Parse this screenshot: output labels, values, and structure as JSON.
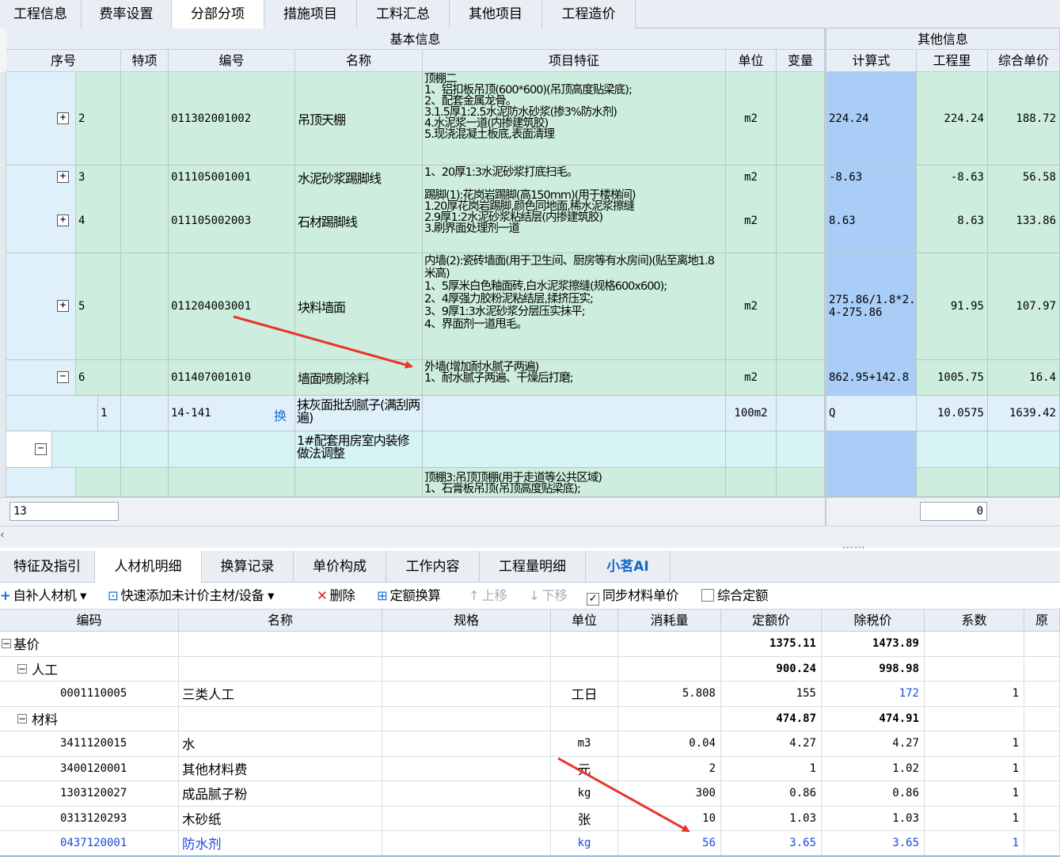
{
  "top_tabs": [
    "工程信息",
    "费率设置",
    "分部分项",
    "措施项目",
    "工料汇总",
    "其他项目",
    "工程造价"
  ],
  "top_active_tab": 2,
  "upper_grid": {
    "group_basic": "基本信息",
    "group_other": "其他信息",
    "columns": {
      "seq": "序号",
      "special": "特项",
      "code": "编号",
      "name": "名称",
      "feature": "项目特征",
      "unit": "单位",
      "var": "变量",
      "formula": "计算式",
      "qty": "工程里",
      "price": "综合单价"
    },
    "rows": [
      {
        "seq": "2",
        "code": "011302001002",
        "name": "吊顶天棚",
        "feature": [
          "顶棚二",
          "1、铝扣板吊顶(600*600)(吊顶高度贴梁底);",
          "2、配套金属龙骨。",
          "3.1.5厚1:2.5水泥防水砂浆(掺3%防水剂)",
          "4.水泥浆一道(内掺建筑胶)",
          "5.现浇混凝土板底,表面清理"
        ],
        "unit": "m2",
        "formula": "224.24",
        "qty": "224.24",
        "price": "188.72"
      },
      {
        "seq": "3",
        "code": "011105001001",
        "name": "水泥砂浆踢脚线",
        "feature": [
          "1、20厚1:3水泥砂浆打底扫毛。"
        ],
        "unit": "m2",
        "formula": "-8.63",
        "qty": "-8.63",
        "price": "56.58"
      },
      {
        "seq": "4",
        "code": "011105002003",
        "name": "石材踢脚线",
        "feature": [
          "踢脚(1):花岗岩踢脚(高150mm)(用于楼梯间)",
          "1.20厚花岗岩踢脚,颜色同地面,稀水泥浆擦缝",
          "2.9厚1:2水泥砂浆粘结层(内掺建筑胶)",
          "3.刷界面处理剂一道"
        ],
        "unit": "m2",
        "formula": "8.63",
        "qty": "8.63",
        "price": "133.86"
      },
      {
        "seq": "5",
        "code": "011204003001",
        "name": "块料墙面",
        "feature": [
          "内墙(2):瓷砖墙面(用于卫生间、厨房等有水房间)(贴至离地1.8米高)",
          "1、5厚米白色釉面砖,白水泥浆擦缝(规格600x600);",
          "2、4厚强力胶粉泥粘结层,揉挤压实;",
          "3、9厚1:3水泥砂浆分层压实抹平;",
          "4、界面剂一道甩毛。"
        ],
        "unit": "m2",
        "formula": "275.86/1.8*2.4-275.86",
        "qty": "91.95",
        "price": "107.97"
      },
      {
        "seq": "6",
        "code": "011407001010",
        "name": "墙面喷刷涂料",
        "feature": [
          "外墙(增加耐水腻子两遍)",
          "1、耐水腻子两遍、干燥后打磨;"
        ],
        "unit": "m2",
        "formula": "862.95+142.8",
        "qty": "1005.75",
        "price": "16.4"
      },
      {
        "seq": "1",
        "code": "14-141",
        "name": "抹灰面批刮腻子(满刮两遍)",
        "swap": "换",
        "feature": [],
        "unit": "100m2",
        "formula": "Q",
        "qty": "10.0575",
        "price": "1639.42"
      },
      {
        "seq": "",
        "code": "",
        "name": "1#配套用房室内装修做法调整",
        "feature": [],
        "unit": "",
        "formula": "",
        "qty": "",
        "price": ""
      },
      {
        "seq": "",
        "code": "",
        "name": "",
        "feature": [
          "顶棚3:吊顶顶棚(用于走道等公共区域)",
          "1、石膏板吊顶(吊顶高度贴梁底);"
        ],
        "unit": "",
        "formula": "",
        "qty": "",
        "price": ""
      }
    ],
    "status_left": "13",
    "status_right": "0"
  },
  "bottom_tabs": [
    "特征及指引",
    "人材机明细",
    "换算记录",
    "单价构成",
    "工作内容",
    "工程量明细",
    "小茗AI"
  ],
  "bottom_active_tab": 1,
  "toolbar": {
    "add": "自补人材机",
    "quick_add": "快速添加未计价主材/设备",
    "delete": "删除",
    "quota_conv": "定额换算",
    "move_up": "上移",
    "move_down": "下移",
    "sync": "同步材料单价",
    "combined": "综合定额"
  },
  "lower_grid": {
    "columns": [
      "编码",
      "名称",
      "规格",
      "单位",
      "消耗量",
      "定额价",
      "除税价",
      "系数",
      "原"
    ],
    "rows": [
      {
        "code": "基价",
        "name": "",
        "unit": "",
        "consumption": "",
        "quota": "1375.11",
        "tax_free": "1473.89",
        "coef": "",
        "level": 0,
        "group": true
      },
      {
        "code": "人工",
        "name": "",
        "unit": "",
        "consumption": "",
        "quota": "900.24",
        "tax_free": "998.98",
        "coef": "",
        "level": 1,
        "group": true
      },
      {
        "code": "0001110005",
        "name": "三类人工",
        "unit": "工日",
        "consumption": "5.808",
        "quota": "155",
        "tax_free": "172",
        "coef": "1",
        "level": 2,
        "tf_blue": true
      },
      {
        "code": "材料",
        "name": "",
        "unit": "",
        "consumption": "",
        "quota": "474.87",
        "tax_free": "474.91",
        "coef": "",
        "level": 1,
        "group": true
      },
      {
        "code": "3411120015",
        "name": "水",
        "unit": "m3",
        "consumption": "0.04",
        "quota": "4.27",
        "tax_free": "4.27",
        "coef": "1",
        "level": 2
      },
      {
        "code": "3400120001",
        "name": "其他材料费",
        "unit": "元",
        "consumption": "2",
        "quota": "1",
        "tax_free": "1.02",
        "coef": "1",
        "level": 2
      },
      {
        "code": "1303120027",
        "name": "成品腻子粉",
        "unit": "kg",
        "consumption": "300",
        "quota": "0.86",
        "tax_free": "0.86",
        "coef": "1",
        "level": 2
      },
      {
        "code": "0313120293",
        "name": "木砂纸",
        "unit": "张",
        "consumption": "10",
        "quota": "1.03",
        "tax_free": "1.03",
        "coef": "1",
        "level": 2
      },
      {
        "code": "0437120001",
        "name": "防水剂",
        "unit": "kg",
        "consumption": "56",
        "quota": "3.65",
        "tax_free": "3.65",
        "coef": "1",
        "level": 2,
        "highlight": true
      }
    ]
  },
  "colors": {
    "accent_blue": "#1849d8",
    "green_row": "#cdeede",
    "formula_blue": "#a9cdf7",
    "arrow_red": "#e8332a"
  }
}
